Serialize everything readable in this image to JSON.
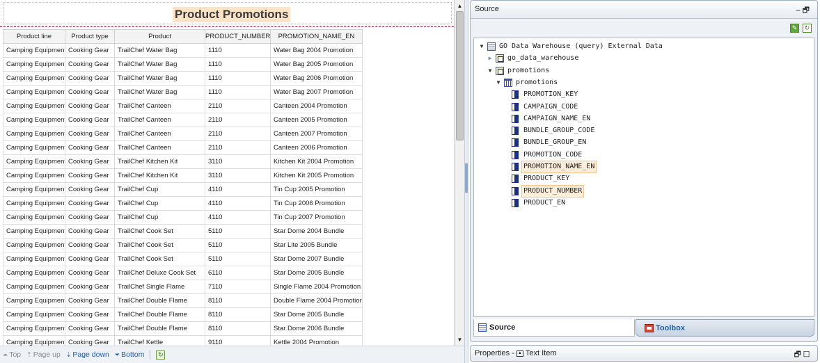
{
  "report": {
    "title": "Product Promotions",
    "columns": [
      "Product line",
      "Product type",
      "Product",
      "PRODUCT_NUMBER",
      "PROMOTION_NAME_EN"
    ],
    "rows": [
      [
        "Camping Equipment",
        "Cooking Gear",
        "TrailChef Water Bag",
        "1110",
        "Water Bag 2004 Promotion"
      ],
      [
        "Camping Equipment",
        "Cooking Gear",
        "TrailChef Water Bag",
        "1110",
        "Water Bag 2005 Promotion"
      ],
      [
        "Camping Equipment",
        "Cooking Gear",
        "TrailChef Water Bag",
        "1110",
        "Water Bag 2006 Promotion"
      ],
      [
        "Camping Equipment",
        "Cooking Gear",
        "TrailChef Water Bag",
        "1110",
        "Water Bag 2007 Promotion"
      ],
      [
        "Camping Equipment",
        "Cooking Gear",
        "TrailChef Canteen",
        "2110",
        "Canteen 2004 Promotion"
      ],
      [
        "Camping Equipment",
        "Cooking Gear",
        "TrailChef Canteen",
        "2110",
        "Canteen 2005 Promotion"
      ],
      [
        "Camping Equipment",
        "Cooking Gear",
        "TrailChef Canteen",
        "2110",
        "Canteen 2007 Promotion"
      ],
      [
        "Camping Equipment",
        "Cooking Gear",
        "TrailChef Canteen",
        "2110",
        "Canteen 2006 Promotion"
      ],
      [
        "Camping Equipment",
        "Cooking Gear",
        "TrailChef Kitchen Kit",
        "3110",
        "Kitchen Kit 2004 Promotion"
      ],
      [
        "Camping Equipment",
        "Cooking Gear",
        "TrailChef Kitchen Kit",
        "3110",
        "Kitchen Kit 2005 Promotion"
      ],
      [
        "Camping Equipment",
        "Cooking Gear",
        "TrailChef Cup",
        "4110",
        "Tin Cup 2005 Promotion"
      ],
      [
        "Camping Equipment",
        "Cooking Gear",
        "TrailChef Cup",
        "4110",
        "Tin Cup 2006 Promotion"
      ],
      [
        "Camping Equipment",
        "Cooking Gear",
        "TrailChef Cup",
        "4110",
        "Tin Cup 2007 Promotion"
      ],
      [
        "Camping Equipment",
        "Cooking Gear",
        "TrailChef Cook Set",
        "5110",
        "Star Dome 2004 Bundle"
      ],
      [
        "Camping Equipment",
        "Cooking Gear",
        "TrailChef Cook Set",
        "5110",
        "Star Lite 2005 Bundle"
      ],
      [
        "Camping Equipment",
        "Cooking Gear",
        "TrailChef Cook Set",
        "5110",
        "Star Dome 2007 Bundle"
      ],
      [
        "Camping Equipment",
        "Cooking Gear",
        "TrailChef Deluxe Cook Set",
        "6110",
        "Star Dome 2005 Bundle"
      ],
      [
        "Camping Equipment",
        "Cooking Gear",
        "TrailChef Single Flame",
        "7110",
        "Single Flame 2004 Promotion"
      ],
      [
        "Camping Equipment",
        "Cooking Gear",
        "TrailChef Double Flame",
        "8110",
        "Double Flame 2004 Promotion"
      ],
      [
        "Camping Equipment",
        "Cooking Gear",
        "TrailChef Double Flame",
        "8110",
        "Star Dome 2005 Bundle"
      ],
      [
        "Camping Equipment",
        "Cooking Gear",
        "TrailChef Double Flame",
        "8110",
        "Star Dome 2006 Bundle"
      ],
      [
        "Camping Equipment",
        "Cooking Gear",
        "TrailChef Kettle",
        "9110",
        "Kettle 2004 Promotion"
      ]
    ]
  },
  "pager": {
    "top": "Top",
    "page_up": "Page up",
    "page_down": "Page down",
    "bottom": "Bottom"
  },
  "source_panel": {
    "title": "Source",
    "tree": [
      {
        "label": "GO Data Warehouse (query) External Data",
        "level": 0,
        "icon": "database-icon",
        "toggle": "open"
      },
      {
        "label": "go_data_warehouse",
        "level": 1,
        "icon": "query-subject-icon",
        "toggle": "closed"
      },
      {
        "label": "promotions",
        "level": 1,
        "icon": "query-subject-icon",
        "toggle": "open"
      },
      {
        "label": "promotions",
        "level": 2,
        "icon": "table-icon",
        "toggle": "open"
      },
      {
        "label": "PROMOTION_KEY",
        "level": 3,
        "icon": "column-icon",
        "toggle": "none"
      },
      {
        "label": "CAMPAIGN_CODE",
        "level": 3,
        "icon": "column-icon",
        "toggle": "none"
      },
      {
        "label": "CAMPAIGN_NAME_EN",
        "level": 3,
        "icon": "column-icon",
        "toggle": "none"
      },
      {
        "label": "BUNDLE_GROUP_CODE",
        "level": 3,
        "icon": "column-icon",
        "toggle": "none"
      },
      {
        "label": "BUNDLE_GROUP_EN",
        "level": 3,
        "icon": "column-icon",
        "toggle": "none"
      },
      {
        "label": "PROMOTION_CODE",
        "level": 3,
        "icon": "column-icon",
        "toggle": "none"
      },
      {
        "label": "PROMOTION_NAME_EN",
        "level": 3,
        "icon": "column-icon",
        "toggle": "none",
        "highlight": true
      },
      {
        "label": "PRODUCT_KEY",
        "level": 3,
        "icon": "column-icon",
        "toggle": "none"
      },
      {
        "label": "PRODUCT_NUMBER",
        "level": 3,
        "icon": "column-icon",
        "toggle": "none",
        "highlight": true
      },
      {
        "label": "PRODUCT_EN",
        "level": 3,
        "icon": "column-icon",
        "toggle": "none"
      }
    ],
    "tabs": {
      "source": "Source",
      "toolbox": "Toolbox"
    }
  },
  "properties_panel": {
    "title": "Properties - ",
    "item": "Text Item"
  },
  "colors": {
    "title_highlight": "#fbe3c6",
    "tree_highlight": "#fdeedb",
    "active_link": "#1f5ea8",
    "divider_red": "#9b1c1c"
  }
}
